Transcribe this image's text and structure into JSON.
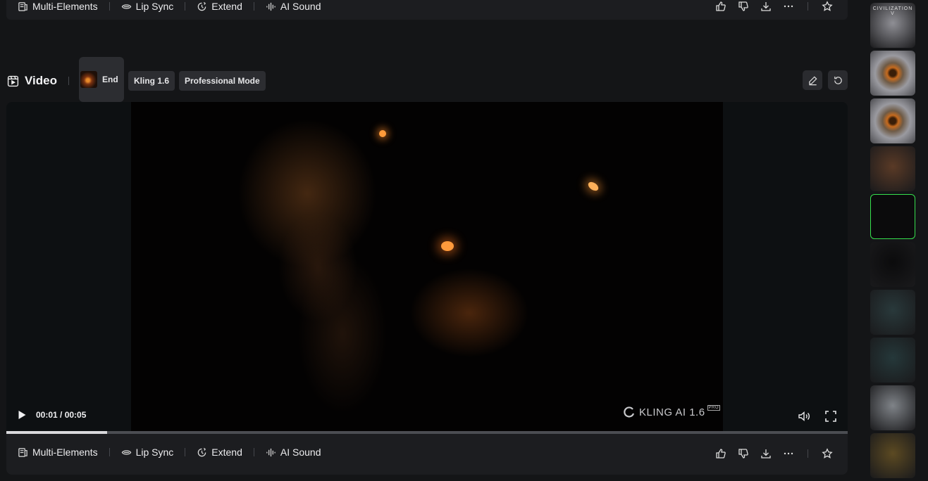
{
  "toolbar": {
    "items": [
      "Multi-Elements",
      "Lip Sync",
      "Extend",
      "AI Sound"
    ]
  },
  "header": {
    "title": "Video",
    "chips": [
      "End",
      "Kling 1.6",
      "Professional Mode"
    ]
  },
  "player": {
    "time": "00:01 / 00:05",
    "progress": 0.12,
    "watermark": "KLING AI 1.6",
    "watermark_badge": "PRO"
  },
  "sidebar": {
    "thumbs": [
      {
        "label": "CIVILIZATION V",
        "bg": "#8f8f95"
      },
      {
        "label": "",
        "bg": "#6b6a6c"
      },
      {
        "label": "",
        "bg": "#6b6a6c"
      },
      {
        "label": "",
        "bg": "#5a3a26"
      },
      {
        "label": "",
        "bg": "#0b0b0c",
        "active": true
      },
      {
        "label": "",
        "bg": "#0b0b0c"
      },
      {
        "label": "",
        "bg": "#29393b"
      },
      {
        "label": "",
        "bg": "#25383a"
      },
      {
        "label": "",
        "bg": "#7f8388"
      },
      {
        "label": "",
        "bg": "#5c4a22"
      }
    ]
  },
  "colors": {
    "accent_active": "#36e04d",
    "background": "#141517"
  }
}
